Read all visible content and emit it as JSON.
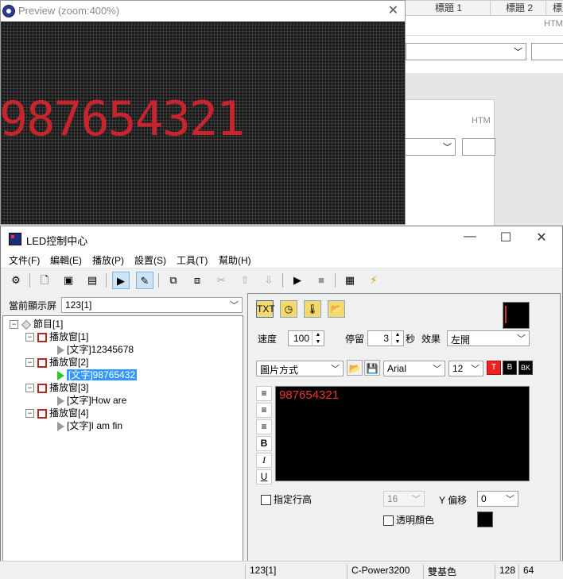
{
  "bg_app": {
    "tabs": [
      "標題 1",
      "標題 2",
      "標題"
    ],
    "html_label": "HTM",
    "html_label_inner": "HTM"
  },
  "preview": {
    "title": "Preview (zoom:400%)",
    "led_text": "987654321",
    "close_glyph": "✕"
  },
  "window": {
    "title": "LED控制中心",
    "minimize": "—",
    "maximize": "☐",
    "close": "✕"
  },
  "menu": [
    "文件(F)",
    "編輯(E)",
    "播放(P)",
    "設置(S)",
    "工具(T)",
    "幫助(H)"
  ],
  "left": {
    "screen_label": "當前顯示屏",
    "screen_value": "123[1]",
    "tree": [
      {
        "label": "節目[1]",
        "indent": 0,
        "kind": "program"
      },
      {
        "label": "播放窗[1]",
        "indent": 1,
        "kind": "window"
      },
      {
        "label": "[文字]12345678",
        "indent": 2,
        "kind": "item"
      },
      {
        "label": "播放窗[2]",
        "indent": 1,
        "kind": "window"
      },
      {
        "label": "[文字]98765432",
        "indent": 2,
        "kind": "item-selected"
      },
      {
        "label": "播放窗[3]",
        "indent": 1,
        "kind": "window"
      },
      {
        "label": "[文字]How are",
        "indent": 2,
        "kind": "item"
      },
      {
        "label": "播放窗[4]",
        "indent": 1,
        "kind": "window"
      },
      {
        "label": "[文字]I am fin",
        "indent": 2,
        "kind": "item"
      }
    ]
  },
  "right": {
    "speed_label": "速度",
    "speed_value": "100",
    "stay_label": "停留",
    "stay_value": "3",
    "seconds_label": "秒",
    "effect_label": "效果",
    "effect_value": "左開",
    "mode_value": "圖片方式",
    "font_value": "Arial",
    "size_value": "12",
    "btn_t": "T",
    "btn_b": "B",
    "btn_bk": "BK",
    "editor_text": "987654321",
    "line_label": "指定行高",
    "line_value": "16",
    "y_offset_label": "Y 偏移",
    "y_offset_value": "0",
    "transparent_label": "透明顏色",
    "fmt_bold": "B",
    "fmt_italic": "I",
    "fmt_underline": "U"
  },
  "status": {
    "screen": "123[1]",
    "controller": "C-Power3200",
    "color": "雙基色",
    "width": "128",
    "height": "64"
  },
  "colors": {
    "led_red": "#c8242e",
    "selection": "#3399ff",
    "text_red": "#e33"
  }
}
